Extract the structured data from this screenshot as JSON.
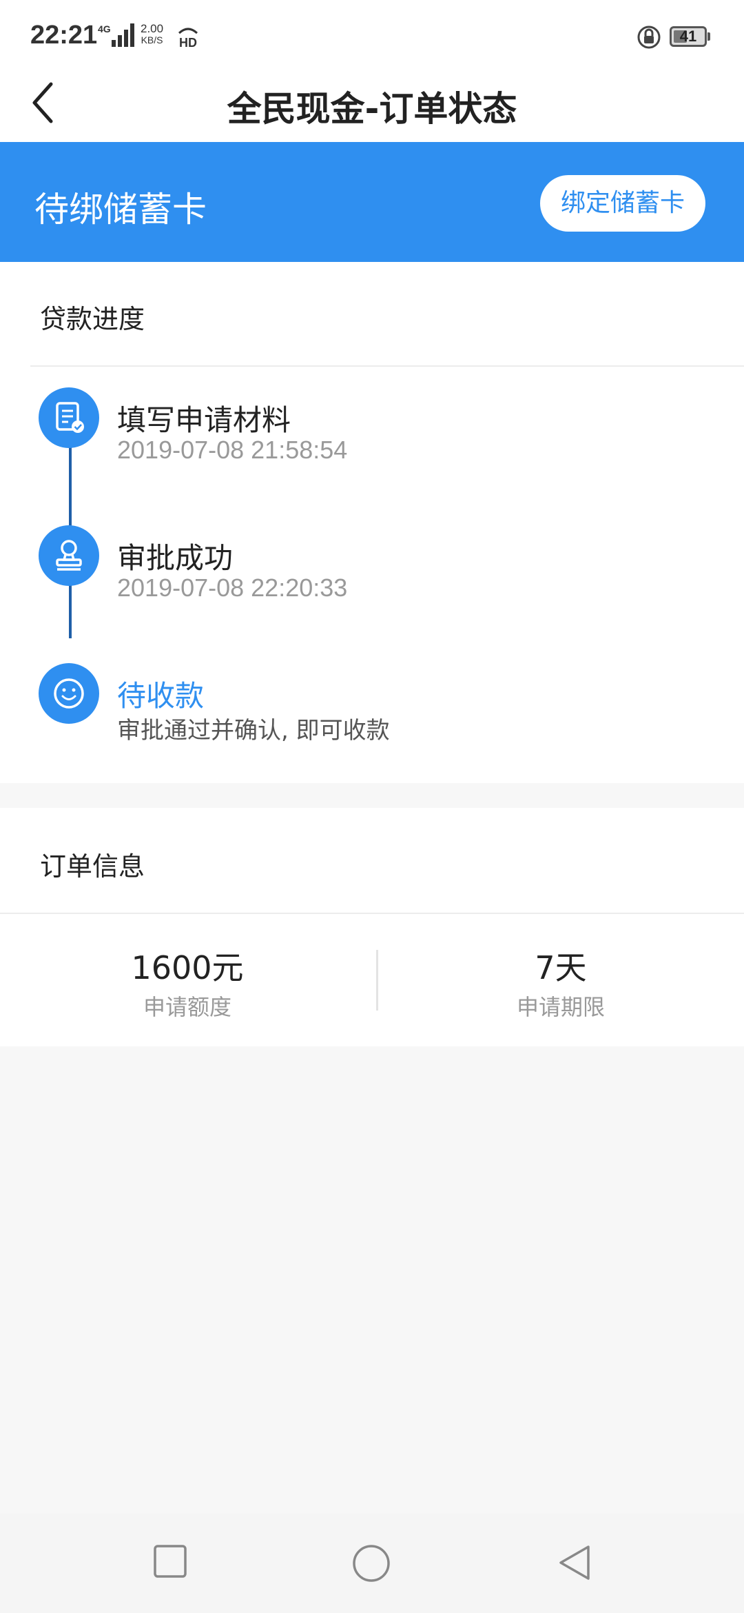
{
  "status_bar": {
    "time": "22:21",
    "network_type": "4G",
    "speed_value": "2.00",
    "speed_unit": "KB/S",
    "hd_label": "HD",
    "battery": "41"
  },
  "header": {
    "title": "全民现金-订单状态",
    "back_icon": "chevron-left-icon"
  },
  "banner": {
    "status": "待绑储蓄卡",
    "action_label": "绑定储蓄卡",
    "color": "#2f8ff0"
  },
  "progress": {
    "title": "贷款进度",
    "steps": [
      {
        "title": "填写申请材料",
        "sub": "2019-07-08 21:58:54",
        "icon": "document-check-icon"
      },
      {
        "title": "审批成功",
        "sub": "2019-07-08 22:20:33",
        "icon": "stamp-icon"
      },
      {
        "title": "待收款",
        "sub": "审批通过并确认, 即可收款",
        "icon": "smile-icon"
      }
    ]
  },
  "order": {
    "title": "订单信息",
    "items": [
      {
        "value": "1600元",
        "label": "申请额度"
      },
      {
        "value": "7天",
        "label": "申请期限"
      }
    ]
  },
  "nav": {
    "recent": "square-icon",
    "home": "circle-icon",
    "back": "triangle-back-icon"
  }
}
